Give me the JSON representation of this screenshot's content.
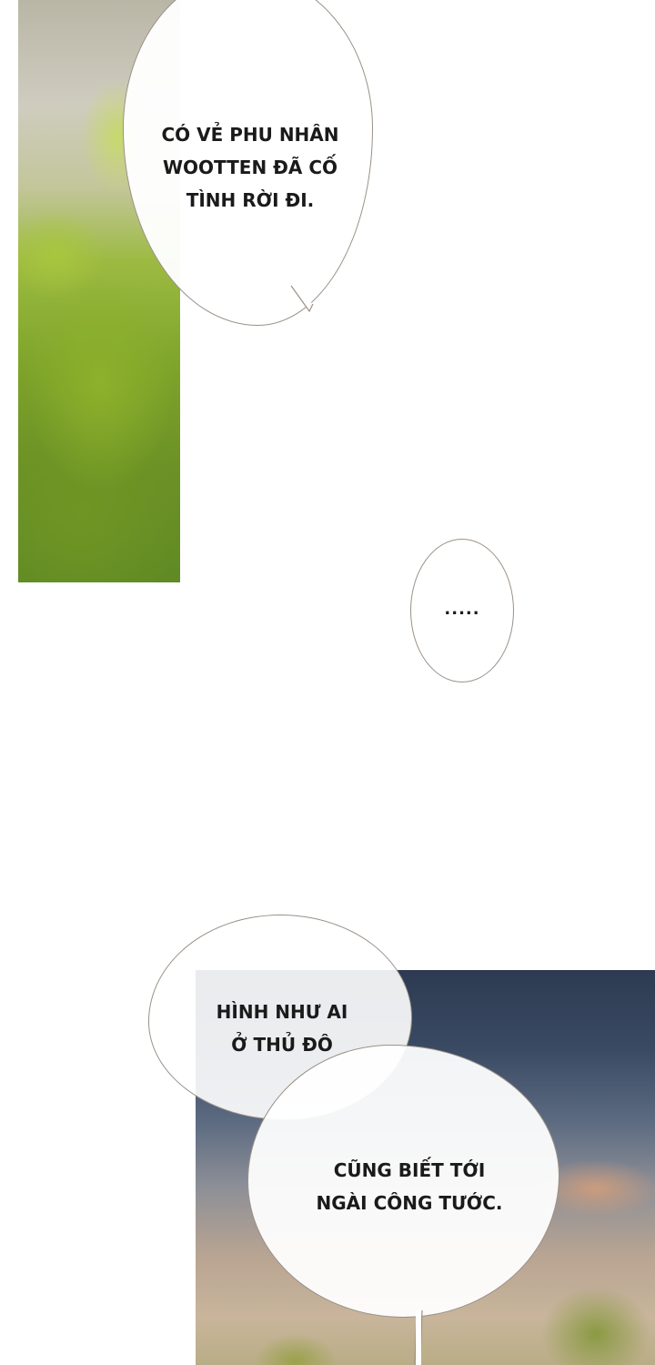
{
  "panels": {
    "top": {
      "scene": "sunlit foliage"
    },
    "bottom": {
      "scene": "evening sky with trees"
    }
  },
  "bubbles": {
    "b1": {
      "lines": [
        "CÓ VẺ PHU NHÂN",
        "WOOTTEN ĐÃ CỐ",
        "TÌNH RỜI ĐI."
      ]
    },
    "b2": {
      "text": "....."
    },
    "b3": {
      "lines": [
        "HÌNH NHƯ AI",
        "Ở THỦ ĐÔ"
      ]
    },
    "b4": {
      "lines": [
        "CŨNG BIẾT TỚI",
        "NGÀI CÔNG TƯỚC."
      ]
    }
  },
  "colors": {
    "bubble_outline": "#9a9187",
    "text": "#1a1a1a",
    "foliage": "#7fa52b",
    "sky": "#2d3a52"
  }
}
